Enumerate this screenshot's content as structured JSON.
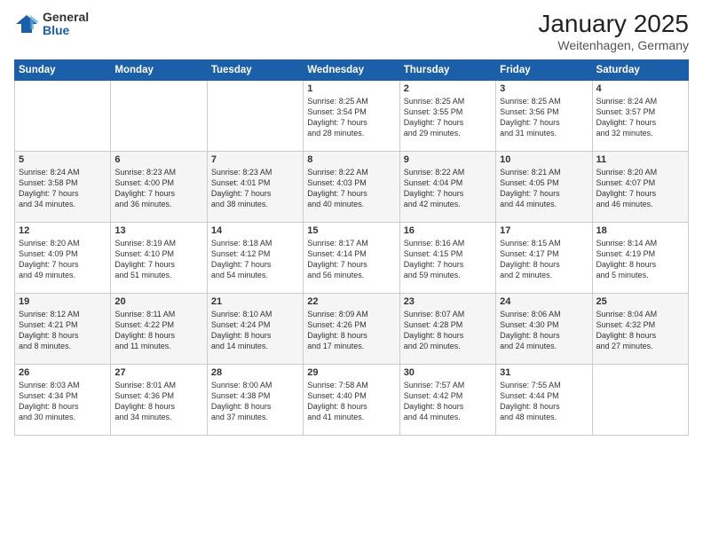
{
  "logo": {
    "general": "General",
    "blue": "Blue"
  },
  "header": {
    "month": "January 2025",
    "location": "Weitenhagen, Germany"
  },
  "weekdays": [
    "Sunday",
    "Monday",
    "Tuesday",
    "Wednesday",
    "Thursday",
    "Friday",
    "Saturday"
  ],
  "rows": [
    [
      {
        "day": "",
        "info": ""
      },
      {
        "day": "",
        "info": ""
      },
      {
        "day": "",
        "info": ""
      },
      {
        "day": "1",
        "info": "Sunrise: 8:25 AM\nSunset: 3:54 PM\nDaylight: 7 hours\nand 28 minutes."
      },
      {
        "day": "2",
        "info": "Sunrise: 8:25 AM\nSunset: 3:55 PM\nDaylight: 7 hours\nand 29 minutes."
      },
      {
        "day": "3",
        "info": "Sunrise: 8:25 AM\nSunset: 3:56 PM\nDaylight: 7 hours\nand 31 minutes."
      },
      {
        "day": "4",
        "info": "Sunrise: 8:24 AM\nSunset: 3:57 PM\nDaylight: 7 hours\nand 32 minutes."
      }
    ],
    [
      {
        "day": "5",
        "info": "Sunrise: 8:24 AM\nSunset: 3:58 PM\nDaylight: 7 hours\nand 34 minutes."
      },
      {
        "day": "6",
        "info": "Sunrise: 8:23 AM\nSunset: 4:00 PM\nDaylight: 7 hours\nand 36 minutes."
      },
      {
        "day": "7",
        "info": "Sunrise: 8:23 AM\nSunset: 4:01 PM\nDaylight: 7 hours\nand 38 minutes."
      },
      {
        "day": "8",
        "info": "Sunrise: 8:22 AM\nSunset: 4:03 PM\nDaylight: 7 hours\nand 40 minutes."
      },
      {
        "day": "9",
        "info": "Sunrise: 8:22 AM\nSunset: 4:04 PM\nDaylight: 7 hours\nand 42 minutes."
      },
      {
        "day": "10",
        "info": "Sunrise: 8:21 AM\nSunset: 4:05 PM\nDaylight: 7 hours\nand 44 minutes."
      },
      {
        "day": "11",
        "info": "Sunrise: 8:20 AM\nSunset: 4:07 PM\nDaylight: 7 hours\nand 46 minutes."
      }
    ],
    [
      {
        "day": "12",
        "info": "Sunrise: 8:20 AM\nSunset: 4:09 PM\nDaylight: 7 hours\nand 49 minutes."
      },
      {
        "day": "13",
        "info": "Sunrise: 8:19 AM\nSunset: 4:10 PM\nDaylight: 7 hours\nand 51 minutes."
      },
      {
        "day": "14",
        "info": "Sunrise: 8:18 AM\nSunset: 4:12 PM\nDaylight: 7 hours\nand 54 minutes."
      },
      {
        "day": "15",
        "info": "Sunrise: 8:17 AM\nSunset: 4:14 PM\nDaylight: 7 hours\nand 56 minutes."
      },
      {
        "day": "16",
        "info": "Sunrise: 8:16 AM\nSunset: 4:15 PM\nDaylight: 7 hours\nand 59 minutes."
      },
      {
        "day": "17",
        "info": "Sunrise: 8:15 AM\nSunset: 4:17 PM\nDaylight: 8 hours\nand 2 minutes."
      },
      {
        "day": "18",
        "info": "Sunrise: 8:14 AM\nSunset: 4:19 PM\nDaylight: 8 hours\nand 5 minutes."
      }
    ],
    [
      {
        "day": "19",
        "info": "Sunrise: 8:12 AM\nSunset: 4:21 PM\nDaylight: 8 hours\nand 8 minutes."
      },
      {
        "day": "20",
        "info": "Sunrise: 8:11 AM\nSunset: 4:22 PM\nDaylight: 8 hours\nand 11 minutes."
      },
      {
        "day": "21",
        "info": "Sunrise: 8:10 AM\nSunset: 4:24 PM\nDaylight: 8 hours\nand 14 minutes."
      },
      {
        "day": "22",
        "info": "Sunrise: 8:09 AM\nSunset: 4:26 PM\nDaylight: 8 hours\nand 17 minutes."
      },
      {
        "day": "23",
        "info": "Sunrise: 8:07 AM\nSunset: 4:28 PM\nDaylight: 8 hours\nand 20 minutes."
      },
      {
        "day": "24",
        "info": "Sunrise: 8:06 AM\nSunset: 4:30 PM\nDaylight: 8 hours\nand 24 minutes."
      },
      {
        "day": "25",
        "info": "Sunrise: 8:04 AM\nSunset: 4:32 PM\nDaylight: 8 hours\nand 27 minutes."
      }
    ],
    [
      {
        "day": "26",
        "info": "Sunrise: 8:03 AM\nSunset: 4:34 PM\nDaylight: 8 hours\nand 30 minutes."
      },
      {
        "day": "27",
        "info": "Sunrise: 8:01 AM\nSunset: 4:36 PM\nDaylight: 8 hours\nand 34 minutes."
      },
      {
        "day": "28",
        "info": "Sunrise: 8:00 AM\nSunset: 4:38 PM\nDaylight: 8 hours\nand 37 minutes."
      },
      {
        "day": "29",
        "info": "Sunrise: 7:58 AM\nSunset: 4:40 PM\nDaylight: 8 hours\nand 41 minutes."
      },
      {
        "day": "30",
        "info": "Sunrise: 7:57 AM\nSunset: 4:42 PM\nDaylight: 8 hours\nand 44 minutes."
      },
      {
        "day": "31",
        "info": "Sunrise: 7:55 AM\nSunset: 4:44 PM\nDaylight: 8 hours\nand 48 minutes."
      },
      {
        "day": "",
        "info": ""
      }
    ]
  ]
}
